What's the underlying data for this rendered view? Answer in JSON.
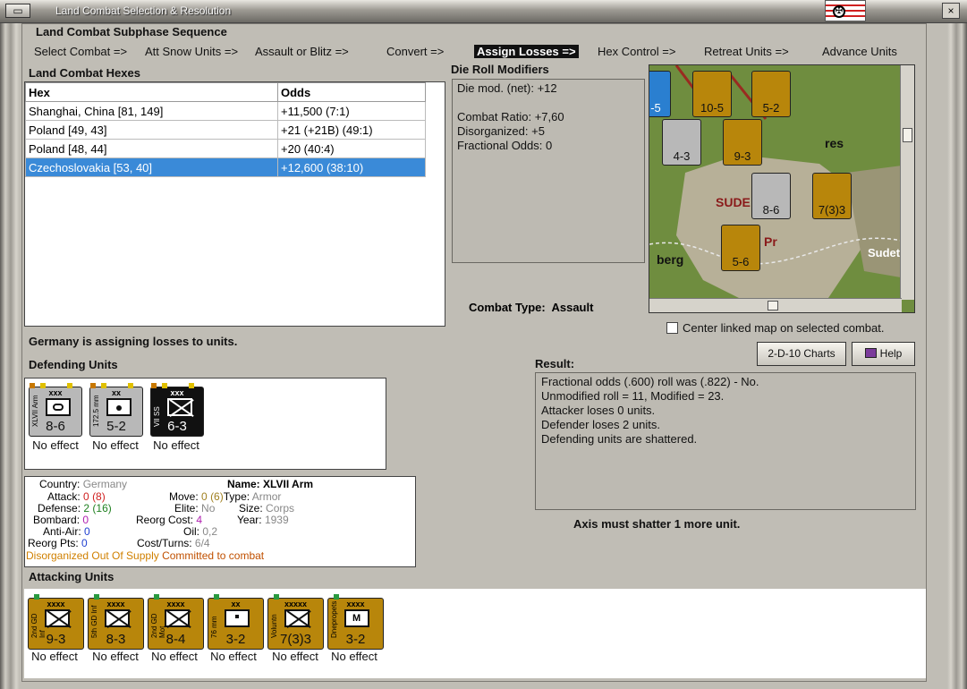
{
  "window": {
    "title": "Land Combat Selection & Resolution",
    "menu_btn": "▭",
    "close": "×"
  },
  "sequence": {
    "title": "Land Combat Subphase Sequence",
    "items": [
      {
        "label": "Select Combat =>",
        "active": false
      },
      {
        "label": "Att Snow Units =>",
        "active": false
      },
      {
        "label": "Assault or Blitz =>",
        "active": false
      },
      {
        "label": "Convert =>",
        "active": false
      },
      {
        "label": "Assign Losses =>",
        "active": true
      },
      {
        "label": "Hex Control =>",
        "active": false
      },
      {
        "label": "Retreat Units =>",
        "active": false
      },
      {
        "label": "Advance Units",
        "active": false
      }
    ]
  },
  "hexes": {
    "title": "Land Combat Hexes",
    "col_hex": "Hex",
    "col_odds": "Odds",
    "rows": [
      {
        "hex": "Shanghai, China [81, 149]",
        "odds": "+11,500 (7:1)",
        "selected": false
      },
      {
        "hex": "Poland [49, 43]",
        "odds": "+21 (+21B) (49:1)",
        "selected": false
      },
      {
        "hex": "Poland [48, 44]",
        "odds": "+20 (40:4)",
        "selected": false
      },
      {
        "hex": "Czechoslovakia [53, 40]",
        "odds": "+12,600 (38:10)",
        "selected": true
      }
    ]
  },
  "die_roll": {
    "title": "Die Roll Modifiers",
    "lines": [
      "Die mod. (net): +12",
      "",
      "Combat Ratio: +7,60",
      "Disorganized: +5",
      "Fractional Odds: 0"
    ]
  },
  "combat_type": {
    "label": "Combat Type:",
    "value": "Assault"
  },
  "center_map": {
    "label": "Center linked map on selected combat.",
    "checked": false
  },
  "buttons": {
    "charts": "2-D-10 Charts",
    "help": "Help"
  },
  "assigning_msg": "Germany is assigning losses to units.",
  "defending": {
    "title": "Defending Units",
    "units": [
      {
        "name": "XLVII Arm",
        "size": "xxx",
        "strength": "8-6",
        "effect": "No effect",
        "color": "grey"
      },
      {
        "name": "172.5 mm",
        "size": "xx",
        "strength": "5-2",
        "effect": "No effect",
        "color": "grey"
      },
      {
        "name": "VII SS",
        "size": "xxx",
        "strength": "6-3",
        "effect": "No effect",
        "color": "black"
      }
    ]
  },
  "result": {
    "title": "Result:",
    "lines": [
      "Fractional odds (.600) roll was (.822)  - No.",
      "Unmodified roll = 11, Modified = 23.",
      "Attacker loses 0 units.",
      "Defender loses 2 units.",
      "Defending units are shattered."
    ],
    "summary": "Axis must shatter 1 more unit."
  },
  "info": {
    "country_label": "Country:",
    "country": "Germany",
    "attack_label": "Attack:",
    "attack": "0",
    "attack_base": "(8)",
    "defense_label": "Defense:",
    "defense": "2",
    "defense_base": "(16)",
    "bombard_label": "Bombard:",
    "bombard": "0",
    "antiair_label": "Anti-Air:",
    "antiair": "0",
    "reorg_pts_label": "Reorg Pts:",
    "reorg_pts": "0",
    "name_label": "Name:",
    "name": "XLVII Arm",
    "type_label": "Type:",
    "type": "Armor",
    "size_label": "Size:",
    "size": "Corps",
    "year_label": "Year:",
    "year": "1939",
    "move_label": "Move:",
    "move": "0",
    "move_base": "(6)",
    "elite_label": "Elite:",
    "elite": "No",
    "reorg_cost_label": "Reorg Cost:",
    "reorg_cost": "4",
    "oil_label": "Oil:",
    "oil": "0,2",
    "cost_turns_label": "Cost/Turns:",
    "cost_turns": "6/4",
    "status1": "Disorganized Out Of Supply",
    "status2": "Committed to combat"
  },
  "attacking": {
    "title": "Attacking Units",
    "units": [
      {
        "name": "2nd GD Inf",
        "size": "xxxx",
        "strength": "9-3",
        "effect": "No effect"
      },
      {
        "name": "5th GD Inf",
        "size": "xxxx",
        "strength": "8-3",
        "effect": "No effect"
      },
      {
        "name": "2nd GD Mot",
        "size": "xxxx",
        "strength": "8-4",
        "effect": "No effect"
      },
      {
        "name": "76 mm",
        "size": "xx",
        "strength": "3-2",
        "effect": "No effect"
      },
      {
        "name": "Voluntn",
        "size": "xxxxx",
        "strength": "7(3)3",
        "effect": "No effect"
      },
      {
        "name": "Dnepropets",
        "size": "xxxx",
        "strength": "3-2",
        "effect": "No effect"
      }
    ]
  },
  "map": {
    "labels": [
      "SUDE",
      "berg",
      "Sudet",
      "Pr",
      "res"
    ],
    "counters": [
      {
        "label": "10-5",
        "size": "xxxx"
      },
      {
        "label": "5-2",
        "size": "xxxx"
      },
      {
        "label": "4-3",
        "size": "xxxx"
      },
      {
        "label": "9-3",
        "size": "xxxx"
      },
      {
        "label": "8-6",
        "size": "xxx"
      },
      {
        "label": "7(3)3",
        "size": "xxxxx"
      },
      {
        "label": "5-6",
        "size": "xxx"
      },
      {
        "label": "-5",
        "size": "xx"
      }
    ]
  },
  "colors": {
    "accent": "#3a8ad8",
    "counter_gold": "#b8860b",
    "counter_grey": "#b8b8b8"
  }
}
